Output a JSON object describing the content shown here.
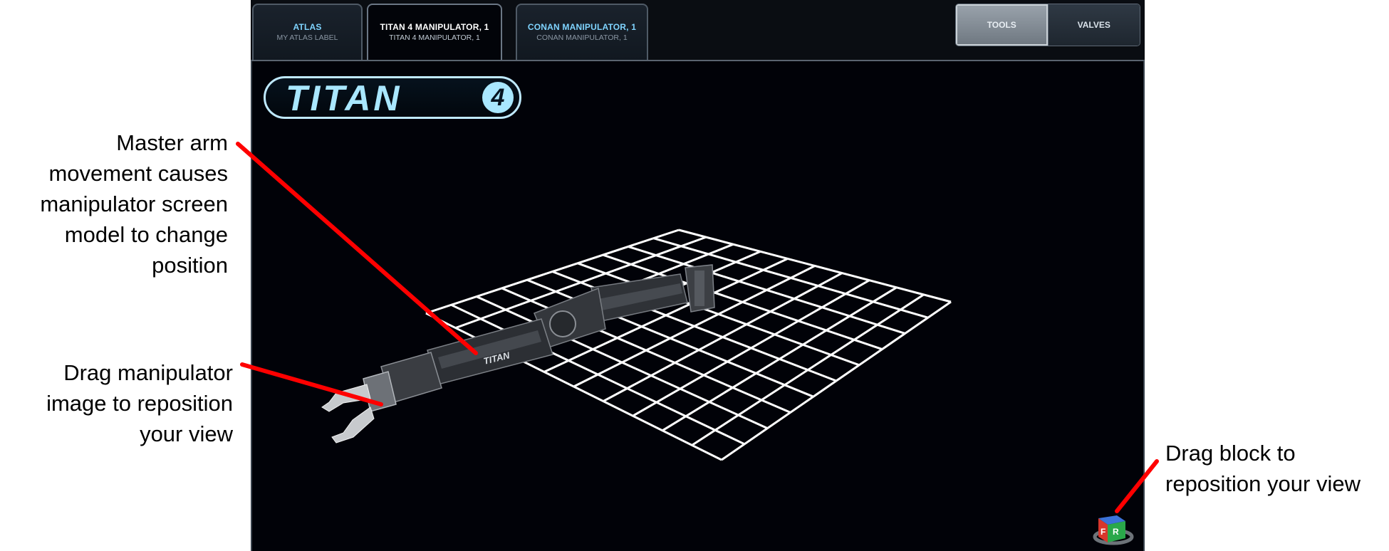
{
  "tabs": [
    {
      "title": "ATLAS",
      "subtitle": "MY ATLAS LABEL",
      "active": false
    },
    {
      "title": "TITAN 4 MANIPULATOR, 1",
      "subtitle": "TITAN 4 MANIPULATOR, 1",
      "active": true
    },
    {
      "title": "CONAN MANIPULATOR, 1",
      "subtitle": "CONAN MANIPULATOR, 1",
      "active": false
    }
  ],
  "toolbar": {
    "tools_label": "TOOLS",
    "valves_label": "VALVES",
    "selected": "TOOLS"
  },
  "logo": {
    "text": "TITAN",
    "number": "4"
  },
  "arm_label": "TITAN",
  "view_cube": {
    "faces": [
      "F",
      "R"
    ]
  },
  "annotations": {
    "master_arm": "Master arm movement causes manipulator screen model to change position",
    "drag_manipulator": "Drag manipulator image to reposition your view",
    "drag_block": "Drag block to reposition your view"
  },
  "colors": {
    "accent": "#7fd4ff",
    "grid": "#ffffff",
    "callout": "#ff0000",
    "background": "#000000"
  }
}
